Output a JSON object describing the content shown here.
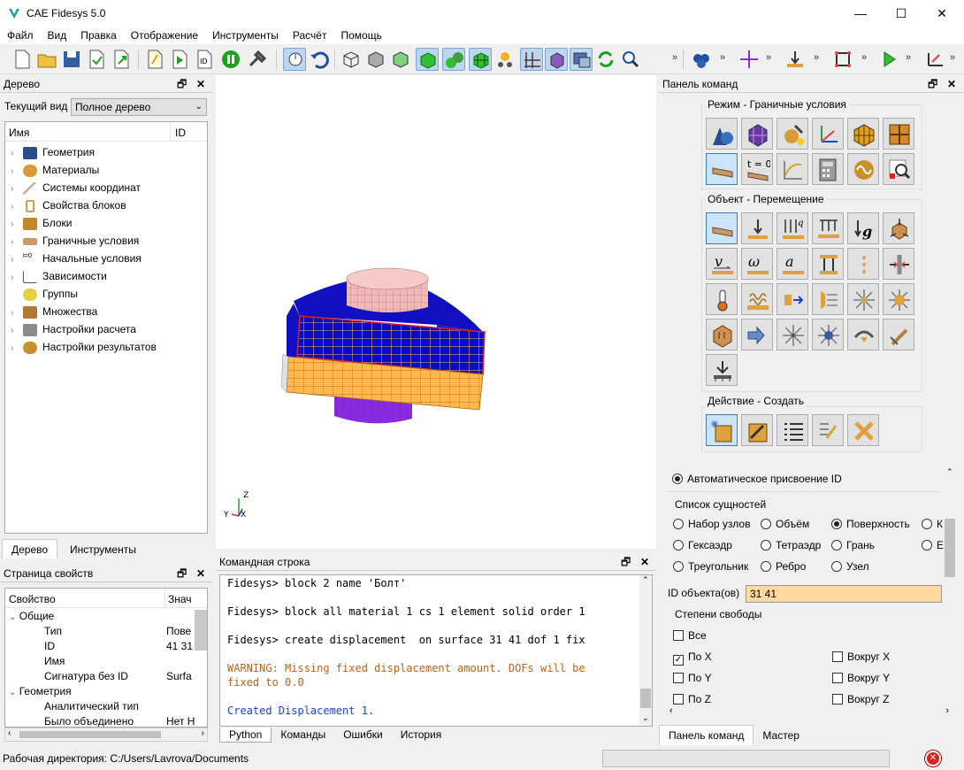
{
  "app": {
    "title": "CAE Fidesys 5.0"
  },
  "menu": [
    "Файл",
    "Вид",
    "Правка",
    "Отображение",
    "Инструменты",
    "Расчёт",
    "Помощь"
  ],
  "tree_panel": {
    "title": "Дерево",
    "current_view_label": "Текущий вид",
    "current_view_value": "Полное дерево",
    "col_name": "Имя",
    "col_id": "ID",
    "items": [
      "Геометрия",
      "Материалы",
      "Системы координат",
      "Свойства блоков",
      "Блоки",
      "Граничные условия",
      "Начальные условия",
      "Зависимости",
      "Группы",
      "Множества",
      "Настройки расчета",
      "Настройки результатов"
    ],
    "tabs": [
      "Дерево",
      "Инструменты"
    ]
  },
  "props_panel": {
    "title": "Страница свойств",
    "col_prop": "Свойство",
    "col_val": "Знач",
    "rows": [
      {
        "name": "Общие",
        "value": ""
      },
      {
        "name": "Тип",
        "value": "Пове"
      },
      {
        "name": "ID",
        "value": "41 31"
      },
      {
        "name": "Имя",
        "value": ""
      },
      {
        "name": "Сигнатура без ID",
        "value": "Surfa"
      },
      {
        "name": "Геометрия",
        "value": ""
      },
      {
        "name": "Аналитический тип",
        "value": ""
      },
      {
        "name": "Было объединено",
        "value": "Нет Н"
      }
    ]
  },
  "console": {
    "title": "Командная строка",
    "lines": [
      {
        "text": "Fidesys> block 2 name 'Болт'",
        "color": "#000000"
      },
      {
        "text": "Fidesys> block all material 1 cs 1 element solid order 1",
        "color": "#000000"
      },
      {
        "text": "Fidesys> create displacement  on surface 31 41 dof 1 fix",
        "color": "#000000"
      },
      {
        "text": "WARNING: Missing fixed displacement amount. DOFs will be",
        "color": "#b5651d"
      },
      {
        "text": "fixed to 0.0",
        "color": "#b5651d"
      },
      {
        "text": "Created Displacement 1.",
        "color": "#2040d0"
      }
    ],
    "tabs": [
      "Python",
      "Команды",
      "Ошибки",
      "История"
    ]
  },
  "command_panel": {
    "title": "Панель команд",
    "mode_label": "Режим - Граничные условия",
    "object_label": "Объект - Перемещение",
    "action_label": "Действие - Создать",
    "auto_id": "Автоматическое присвоение ID",
    "entity_list": "Список сущностей",
    "entities": [
      {
        "label": "Набор узлов",
        "on": false
      },
      {
        "label": "Объём",
        "on": false
      },
      {
        "label": "Поверхность",
        "on": true
      },
      {
        "label": "К",
        "on": false
      },
      {
        "label": "Гексаэдр",
        "on": false
      },
      {
        "label": "Тетраэдр",
        "on": false
      },
      {
        "label": "Грань",
        "on": false
      },
      {
        "label": "Е",
        "on": false
      },
      {
        "label": "Треугольник",
        "on": false
      },
      {
        "label": "Ребро",
        "on": false
      },
      {
        "label": "Узел",
        "on": false
      }
    ],
    "object_id_label": "ID объекта(ов)",
    "object_id_value": "31 41",
    "dof_label": "Степени свободы",
    "dofs": [
      {
        "label": "Все",
        "on": false
      },
      {
        "label": "По X",
        "on": true
      },
      {
        "label": "Вокруг X",
        "on": false
      },
      {
        "label": "По Y",
        "on": false
      },
      {
        "label": "Вокруг Y",
        "on": false
      },
      {
        "label": "По Z",
        "on": false
      },
      {
        "label": "Вокруг Z",
        "on": false
      }
    ],
    "tabs": [
      "Панель команд",
      "Мастер"
    ],
    "t0_label": "t = 0"
  },
  "viewport": {
    "axis_z": "Z",
    "axis_x": "X",
    "axis_y": "Y"
  },
  "status": {
    "text": "Рабочая директория: C:/Users/Lavrova/Documents"
  },
  "colors": {
    "accent": "#3c7fb1",
    "mesh_blue": "#0a0ac8",
    "mesh_orange": "#ffb84d",
    "mesh_pink": "#f2b8b8",
    "mesh_purple": "#8a2be2",
    "id_field": "#ffd9a0"
  }
}
